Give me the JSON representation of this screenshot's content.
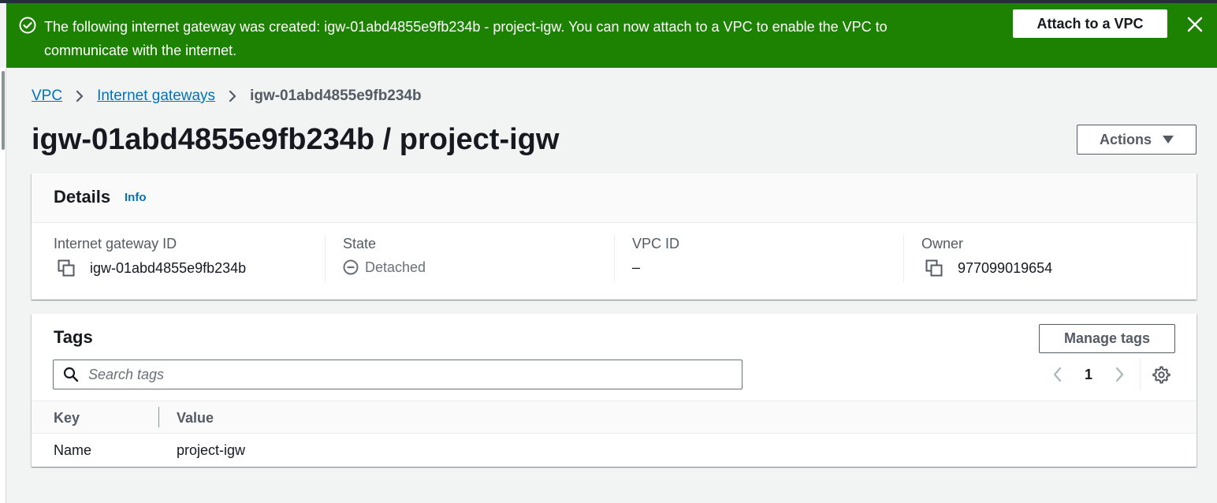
{
  "flash": {
    "message": "The following internet gateway was created: igw-01abd4855e9fb234b - project-igw. You can now attach to a VPC to enable the VPC to communicate with the internet.",
    "action_label": "Attach to a VPC",
    "type": "success",
    "icon": "check-circle-icon",
    "color": "#1d8102"
  },
  "breadcrumb": {
    "items": [
      "VPC",
      "Internet gateways"
    ],
    "current": "igw-01abd4855e9fb234b"
  },
  "page": {
    "title": "igw-01abd4855e9fb234b / project-igw",
    "actions_label": "Actions"
  },
  "details": {
    "title": "Details",
    "info_label": "Info",
    "fields": [
      {
        "label": "Internet gateway ID",
        "value": "igw-01abd4855e9fb234b"
      },
      {
        "label": "State",
        "value": "Detached"
      },
      {
        "label": "VPC ID",
        "value": "–"
      },
      {
        "label": "Owner",
        "value": "977099019654"
      }
    ]
  },
  "tags": {
    "title": "Tags",
    "manage_label": "Manage tags",
    "search_placeholder": "Search tags",
    "page_number": "1",
    "columns": [
      "Key",
      "Value"
    ],
    "rows": [
      {
        "key": "Name",
        "value": "project-igw"
      }
    ]
  },
  "colors": {
    "link": "#0073bb",
    "success": "#1d8102",
    "text": "#16191f",
    "muted": "#545b64"
  }
}
